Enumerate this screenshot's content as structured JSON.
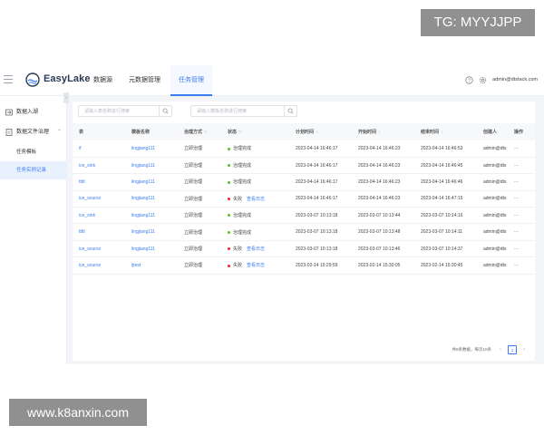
{
  "brand": {
    "name": "EasyLake"
  },
  "nav": [
    {
      "label": "数据源",
      "active": false
    },
    {
      "label": "元数据管理",
      "active": false
    },
    {
      "label": "任务管理",
      "active": true
    }
  ],
  "header": {
    "user": "admin@dtstack.com"
  },
  "sidebar": {
    "items": [
      {
        "label": "数据入湖"
      },
      {
        "label": "数据文件治理"
      }
    ],
    "sub_items": [
      {
        "label": "任务模板",
        "active": false
      },
      {
        "label": "任务实例记录",
        "active": true
      }
    ]
  },
  "filters": {
    "table_search_placeholder": "请输入表名称进行搜索",
    "template_search_placeholder": "请输入模板名称进行搜索"
  },
  "table": {
    "columns": [
      "表",
      "模板名称",
      "治理方式",
      "状态",
      "计划时间",
      "开始时间",
      "结束时间",
      "创建人",
      "操作"
    ],
    "rows": [
      {
        "table": "if",
        "template": "lingjiang111",
        "mode": "立即治理",
        "status": "治理完成",
        "status_type": "success",
        "log": "",
        "plan": "2023-04-14 16:46:17",
        "start": "2023-04-14 16:46:23",
        "end": "2023-04-14 16:46:53",
        "creator": "admin@dts",
        "op": "···"
      },
      {
        "table": "ice_sink",
        "template": "lingjiang111",
        "mode": "立即治理",
        "status": "治理完成",
        "status_type": "success",
        "log": "",
        "plan": "2023-04-14 16:46:17",
        "start": "2023-04-14 16:46:23",
        "end": "2023-04-14 16:46:45",
        "creator": "admin@dts",
        "op": "···"
      },
      {
        "table": "ttttl",
        "template": "lingjiang111",
        "mode": "立即治理",
        "status": "治理完成",
        "status_type": "success",
        "log": "",
        "plan": "2023-04-14 16:46:17",
        "start": "2023-04-14 16:46:23",
        "end": "2023-04-14 16:46:46",
        "creator": "admin@dts",
        "op": "···"
      },
      {
        "table": "ice_source",
        "template": "lingjiang111",
        "mode": "立即治理",
        "status": "失败",
        "status_type": "fail",
        "log": "查看日志",
        "plan": "2023-04-14 16:46:17",
        "start": "2023-04-14 16:46:23",
        "end": "2023-04-14 16:47:15",
        "creator": "admin@dts",
        "op": "···"
      },
      {
        "table": "ice_sink",
        "template": "lingjiang111",
        "mode": "立即治理",
        "status": "治理完成",
        "status_type": "success",
        "log": "",
        "plan": "2023-03-07 10:13:18",
        "start": "2023-03-07 10:13:44",
        "end": "2023-03-07 10:14:16",
        "creator": "admin@dts",
        "op": "···"
      },
      {
        "table": "ttttl",
        "template": "lingjiang111",
        "mode": "立即治理",
        "status": "治理完成",
        "status_type": "success",
        "log": "",
        "plan": "2023-03-07 10:13:18",
        "start": "2023-03-07 10:13:48",
        "end": "2023-03-07 10:14:11",
        "creator": "admin@dts",
        "op": "···"
      },
      {
        "table": "ice_source",
        "template": "lingjiang111",
        "mode": "立即治理",
        "status": "失败",
        "status_type": "fail",
        "log": "查看日志",
        "plan": "2023-03-07 10:13:18",
        "start": "2023-03-07 10:13:46",
        "end": "2023-03-07 10:14:37",
        "creator": "admin@dts",
        "op": "···"
      },
      {
        "table": "ice_source",
        "template": "ljtest",
        "mode": "立即治理",
        "status": "失败",
        "status_type": "fail",
        "log": "查看日志",
        "plan": "2023-02-14 15:29:59",
        "start": "2023-02-14 15:30:05",
        "end": "2023-02-14 15:30:45",
        "creator": "admin@dts",
        "op": "···"
      }
    ]
  },
  "pagination": {
    "total_text": "共8条数据，每页10条",
    "current": "1",
    "prev": "‹",
    "next": "›"
  },
  "colors": {
    "accent": "#3b7cf0",
    "success": "#52c41a",
    "fail": "#f5222d"
  },
  "watermarks": {
    "top": "TG: MYYJJPP",
    "bottom": "www.k8anxin.com"
  }
}
